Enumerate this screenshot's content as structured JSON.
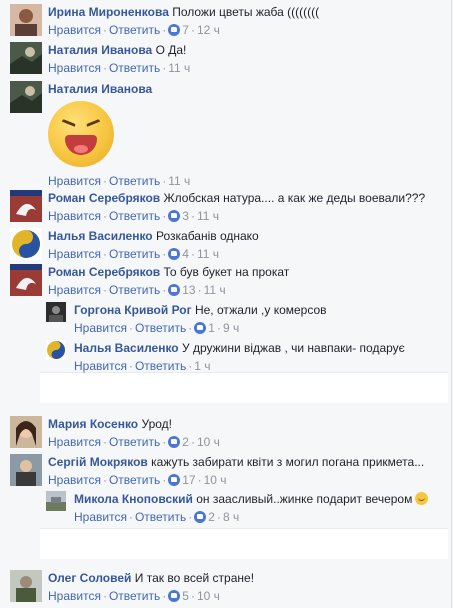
{
  "actions": {
    "like": "Нравится",
    "reply": "Ответить"
  },
  "comments": [
    {
      "author": "Ирина Мироненкова",
      "text": "Положи цветы жаба ((((((((",
      "likes": "7",
      "time": "12 ч"
    },
    {
      "author": "Наталия Иванова",
      "text": "О Да!",
      "likes": "",
      "time": "11 ч"
    },
    {
      "author": "Наталия Иванова",
      "text": "",
      "likes": "",
      "time": "11 ч",
      "sticker": "laughing-face-sticker"
    },
    {
      "author": "Роман Серебряков",
      "text": "Жлобская натура.... а как же деды воевали???",
      "likes": "3",
      "time": "11 ч"
    },
    {
      "author": "Налья Василенко",
      "text": "Розкабанів однако",
      "likes": "4",
      "time": "11 ч"
    },
    {
      "author": "Роман Серебряков",
      "text": "То був букет на прокат",
      "likes": "13",
      "time": "11 ч"
    },
    {
      "author": "Горгона Кривой Рог",
      "text": "Не, отжали ,у комерсов",
      "likes": "1",
      "time": "9 ч"
    },
    {
      "author": "Налья Василенко",
      "text": "У дружини віджав , чи навпаки- подарує",
      "likes": "",
      "time": "1 ч"
    },
    {
      "author": "Мария Косенко",
      "text": "Урод!",
      "likes": "2",
      "time": "10 ч"
    },
    {
      "author": "Сергій Мокряков",
      "text": "кажуть забирати квіти з могил погана прикмета...",
      "likes": "17",
      "time": "10 ч"
    },
    {
      "author": "Микола Кноповский",
      "text": "он заасливый..жинке подарит вечером",
      "likes": "2",
      "time": "8 ч"
    },
    {
      "author": "Олег Соловей",
      "text": "И так во всей стране!",
      "likes": "5",
      "time": "10 ч"
    }
  ]
}
